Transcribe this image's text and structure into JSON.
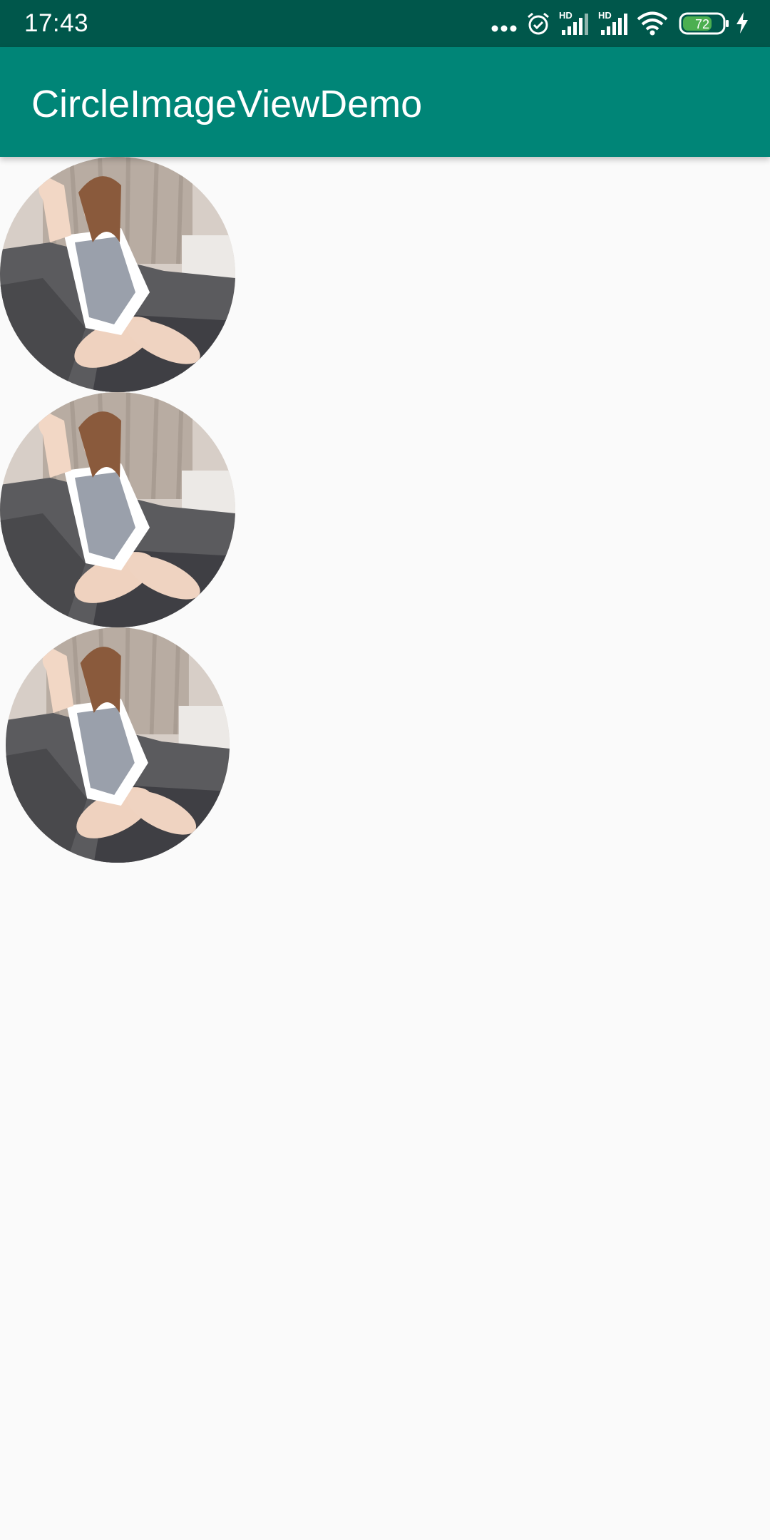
{
  "status_bar": {
    "time": "17:43",
    "icons": [
      "more-dots-icon",
      "alarm-icon",
      "signal-hd-icon",
      "signal-hd-icon",
      "wifi-icon",
      "battery-icon",
      "charging-icon"
    ],
    "signal_1_label": "HD",
    "signal_2_label": "HD",
    "battery_level": "72",
    "colors": {
      "background": "#00574b",
      "battery_fill": "#4caf50"
    }
  },
  "app_bar": {
    "title": "CircleImageViewDemo",
    "color": "#008577"
  },
  "images": [
    {
      "type": "photo-woman-on-sofa"
    },
    {
      "type": "photo-woman-on-sofa"
    },
    {
      "type": "photo-woman-on-sofa"
    }
  ]
}
